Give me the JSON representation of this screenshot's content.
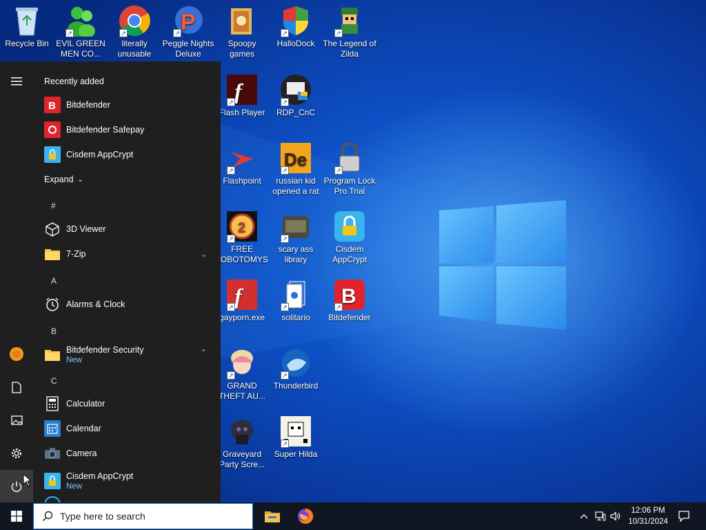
{
  "desktop": {
    "icons": [
      {
        "label": "Recycle Bin",
        "icon": "recycle-bin-icon"
      },
      {
        "label": "EVIL GREEN MEN CO...",
        "icon": "people-icon"
      },
      {
        "label": "literally unusable",
        "icon": "chrome-icon"
      },
      {
        "label": "Peggle Nights Deluxe",
        "icon": "peggle-icon"
      },
      {
        "label": "Spoopy games",
        "icon": "folder-icon"
      },
      {
        "label": "HalloDock",
        "icon": "shield-icon"
      },
      {
        "label": "The Legend of Zilda",
        "icon": "link-sprite-icon"
      },
      {
        "label": "Flash Player",
        "icon": "flash-icon"
      },
      {
        "label": "RDP_CnC",
        "icon": "rdp-icon"
      },
      {
        "label": "Flashpoint",
        "icon": "flashpoint-icon"
      },
      {
        "label": "russian kid opened a rat",
        "icon": "de-icon"
      },
      {
        "label": "Program Lock Pro Trial",
        "icon": "padlock-icon"
      },
      {
        "label": "FREE LOBOTOMYS",
        "icon": "gauge-icon"
      },
      {
        "label": "scary ass library",
        "icon": "library-icon"
      },
      {
        "label": "Cisdem AppCrypt",
        "icon": "appcrypt-icon"
      },
      {
        "label": "gayporn.exe",
        "icon": "flash-icon"
      },
      {
        "label": "solitario",
        "icon": "solitaire-icon"
      },
      {
        "label": "Bitdefender",
        "icon": "bitdefender-icon"
      },
      {
        "label": "GRAND THEFT AU...",
        "icon": "anime-girl-icon"
      },
      {
        "label": "Thunderbird",
        "icon": "thunderbird-icon"
      },
      {
        "label": "Graveyard Party Scre...",
        "icon": "graveyard-icon"
      },
      {
        "label": "Super Hilda",
        "icon": "pixel-sprite-icon"
      }
    ]
  },
  "start_menu": {
    "recently_added_title": "Recently added",
    "recent": [
      {
        "name": "Bitdefender",
        "color": "#e0242d"
      },
      {
        "name": "Bitdefender Safepay",
        "color": "#e0242d"
      },
      {
        "name": "Cisdem AppCrypt",
        "color": "#29a8e8"
      }
    ],
    "expand_label": "Expand",
    "groups": [
      {
        "letter": "#",
        "apps": [
          {
            "name": "3D Viewer"
          },
          {
            "name": "7-Zip"
          }
        ]
      },
      {
        "letter": "A",
        "apps": [
          {
            "name": "Alarms & Clock"
          }
        ]
      },
      {
        "letter": "B",
        "apps": [
          {
            "name": "Bitdefender Security",
            "sub": "New"
          }
        ]
      },
      {
        "letter": "C",
        "apps": [
          {
            "name": "Calculator"
          },
          {
            "name": "Calendar"
          },
          {
            "name": "Camera"
          },
          {
            "name": "Cisdem AppCrypt",
            "sub": "New"
          }
        ]
      }
    ],
    "rail": [
      "hamburger-menu-icon",
      "user-avatar-icon",
      "documents-icon",
      "pictures-icon",
      "settings-gear-icon",
      "power-icon"
    ]
  },
  "taskbar": {
    "search_placeholder": "Type here to search",
    "pinned": [
      "file-explorer-icon",
      "firefox-icon"
    ],
    "clock_time": "12:06 PM",
    "clock_date": "10/31/2024"
  }
}
